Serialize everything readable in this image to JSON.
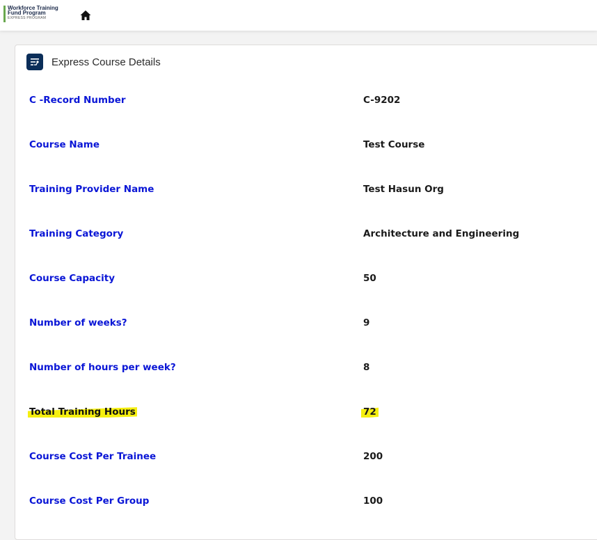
{
  "header": {
    "logo": {
      "line1": "Workforce Training",
      "line2": "Fund Program",
      "line3": "EXPRESS PROGRAM"
    },
    "home_icon": "home-icon"
  },
  "card": {
    "title": "Express Course Details",
    "icon": "flow-icon",
    "fields": [
      {
        "label": "C -Record Number",
        "value": "C-9202",
        "highlighted": false
      },
      {
        "label": "Course Name",
        "value": "Test Course",
        "highlighted": false
      },
      {
        "label": "Training Provider Name",
        "value": "Test Hasun Org",
        "highlighted": false
      },
      {
        "label": "Training Category",
        "value": "Architecture and Engineering",
        "highlighted": false
      },
      {
        "label": "Course Capacity",
        "value": "50",
        "highlighted": false
      },
      {
        "label": "Number of weeks?",
        "value": "9",
        "highlighted": false
      },
      {
        "label": "Number of hours per week?",
        "value": "8",
        "highlighted": false
      },
      {
        "label": "Total Training Hours",
        "value": "72",
        "highlighted": true
      },
      {
        "label": "Course Cost Per Trainee",
        "value": "200",
        "highlighted": false
      },
      {
        "label": "Course Cost Per Group",
        "value": "100",
        "highlighted": false
      }
    ]
  },
  "colors": {
    "label": "#0a16d6",
    "highlight": "#f5ef10",
    "card_icon_bg": "#0b2e59"
  }
}
